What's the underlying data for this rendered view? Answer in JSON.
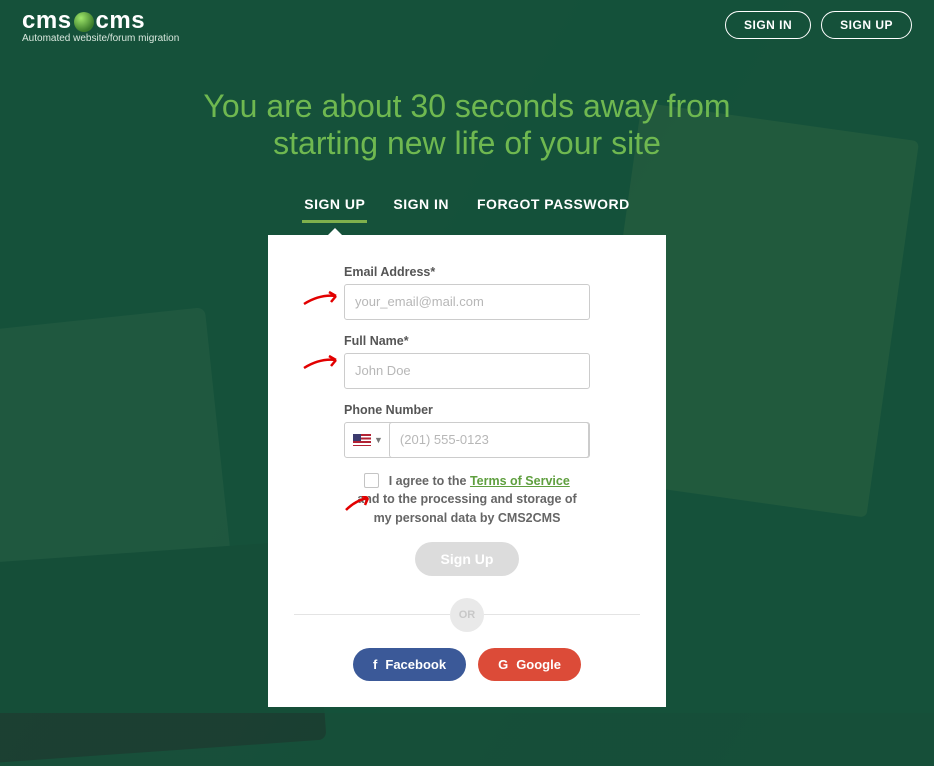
{
  "brand": {
    "name_left": "cms",
    "name_right": "cms",
    "tagline": "Automated website/forum migration"
  },
  "header": {
    "sign_in": "SIGN IN",
    "sign_up": "SIGN UP"
  },
  "hero": {
    "line1": "You are about 30 seconds away from",
    "line2": "starting new life of your site"
  },
  "tabs": {
    "sign_up": "SIGN UP",
    "sign_in": "SIGN IN",
    "forgot": "FORGOT PASSWORD",
    "active": "sign_up"
  },
  "form": {
    "email_label": "Email Address*",
    "email_placeholder": "your_email@mail.com",
    "email_value": "",
    "name_label": "Full Name*",
    "name_placeholder": "John Doe",
    "name_value": "",
    "phone_label": "Phone Number",
    "phone_placeholder": "(201) 555-0123",
    "phone_value": "",
    "phone_country": "US",
    "terms_prefix": "I agree to the ",
    "terms_link": "Terms of Service",
    "terms_line2": "and to the processing and storage of",
    "terms_line3": "my personal data by CMS2CMS",
    "terms_checked": false,
    "submit": "Sign Up"
  },
  "divider": {
    "or": "OR"
  },
  "social": {
    "facebook": "Facebook",
    "google": "Google"
  },
  "annotations": {
    "arrows": [
      "email",
      "name",
      "checkbox"
    ],
    "highlight_color": "#e20000"
  }
}
